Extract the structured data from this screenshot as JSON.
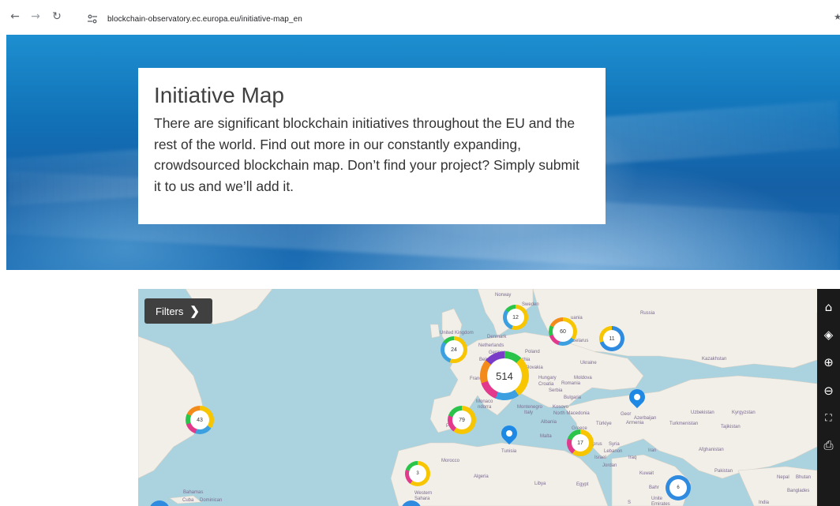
{
  "browser": {
    "back_icon": "arrow-left-icon",
    "forward_icon": "arrow-right-icon",
    "reload_icon": "reload-icon",
    "url": "blockchain-observatory.ec.europa.eu/initiative-map_en"
  },
  "intro": {
    "title": "Initiative Map",
    "text": "There are significant blockchain initiatives throughout the EU and the rest of the world. Find out more in our constantly expanding, crowdsourced blockchain map. Don’t find your project? Simply submit it to us and we’ll add it."
  },
  "map": {
    "filters_label": "Filters",
    "toolbar_icons": [
      "home-icon",
      "layers-icon",
      "zoom-in-icon",
      "zoom-out-icon",
      "fullscreen-icon",
      "print-icon"
    ],
    "clusters": [
      "12",
      "60",
      "11",
      "24",
      "514",
      "43",
      "79",
      "17",
      "3",
      "6"
    ],
    "labels": {
      "norway": "Norway",
      "sweden": "Sweden",
      "russia": "Russia",
      "lithuania": "uania",
      "uk": "United Kingdom",
      "denmark": "Denmark",
      "belarus": "Belarus",
      "netherlands": "Netherlands",
      "germany": "Germany",
      "poland": "Poland",
      "belgium": "Belg",
      "czechia": "echia",
      "slovakia": "Slovakia",
      "ukraine": "Ukraine",
      "kazakhstan": "Kazakhstan",
      "france": "Franc",
      "austria": "ria",
      "hungary": "Hungary",
      "moldova": "Moldova",
      "romania": "Romania",
      "croatia": "Croatia",
      "serbia": "Serbia",
      "bulgaria": "Bulgaria",
      "georgia": "Geor",
      "azerbaijan": "Azerbaijan",
      "armenia": "Armenia",
      "uzbekistan": "Uzbekistan",
      "kyrgyzstan": "Kyrgyzstan",
      "monaco": "Monaco",
      "andorra": "ndorra",
      "montenegro": "Montenegro",
      "kosovo": "Kosovo",
      "italy": "Italy",
      "north_macedonia": "North Macedonia",
      "turkmenistan": "Turkmenistan",
      "tajikistan": "Tajikistan",
      "portugal": "Portugal",
      "albania": "Albania",
      "greece": "Greece",
      "turkiye": "Türkiye",
      "malta": "Malta",
      "tunisia": "Tunisia",
      "syria": "Syria",
      "cyprus": "prus",
      "lebanon": "Lebanon",
      "iraq": "Iraq",
      "iran": "Iran",
      "afghanistan": "Afghanistan",
      "israel": "Israel",
      "jordan": "Jordan",
      "morocco": "Morocco",
      "algeria": "Algeria",
      "libya": "Libya",
      "egypt": "Egypt",
      "kuwait": "Kuwait",
      "pakistan": "Pakistan",
      "nepal": "Nepal",
      "bhutan": "Bhutan",
      "bahrain": "Bahr",
      "bangladesh": "Banglades",
      "bahamas": "Bahamas",
      "cuba": "Cuba",
      "dominican": "Dominican",
      "western_sahara": "Western\nSahara",
      "uae": "Unite\nEmirates",
      "india": "India",
      "sa": "S"
    }
  },
  "colors": {
    "water": "#aad3df",
    "land": "#f2efe9",
    "toolbar": "#1a1a1a",
    "filters_button": "#404040",
    "pin": "#1e88e5"
  }
}
